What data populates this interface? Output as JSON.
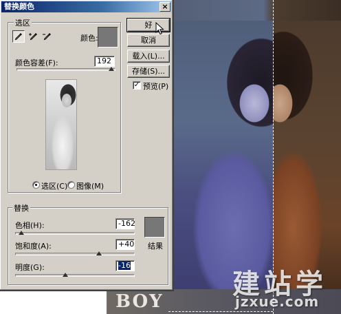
{
  "background": {
    "poster_text": "BOY",
    "watermark_chars": "建站学",
    "watermark_url": "jzxue.com"
  },
  "dialog": {
    "title": "替换颜色",
    "close_glyph": "×",
    "selection": {
      "group_label": "选区",
      "color_label": "颜色:",
      "fuzziness_label": "颜色容差(F):",
      "fuzziness_value": "192",
      "fuzziness_level": 0.96,
      "radio_selection": "选区(C)",
      "radio_image": "图像(M)",
      "selected_mode": "选区"
    },
    "replace": {
      "group_label": "替换",
      "hue_label": "色相(H):",
      "hue_value": "-162",
      "hue_level": 0.05,
      "saturation_label": "饱和度(A):",
      "saturation_value": "+40",
      "saturation_level": 0.7,
      "lightness_label": "明度(G):",
      "lightness_value": "-16",
      "lightness_level": 0.42,
      "result_label": "结果"
    },
    "buttons": {
      "ok": "好",
      "cancel": "取消",
      "load": "载入(L)...",
      "save": "存储(S)..."
    },
    "preview_label": "预览(P)",
    "preview_checked": true
  }
}
